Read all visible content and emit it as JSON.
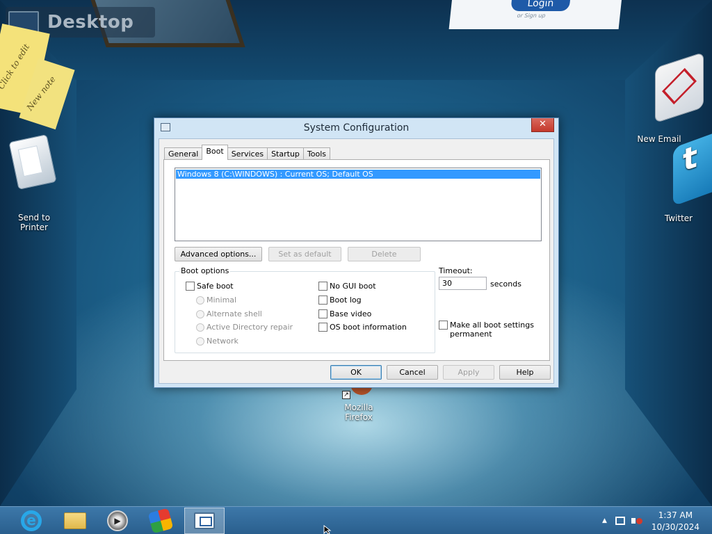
{
  "desktop": {
    "title": "Desktop",
    "notes": [
      "Click to edit",
      "New note"
    ],
    "login": {
      "button": "Login",
      "sub": "or Sign up"
    },
    "icons": {
      "send_to_printer": [
        "Send to",
        "Printer"
      ],
      "new_email": "New Email",
      "twitter": "Twitter",
      "firefox": [
        "Mozilla",
        "Firefox"
      ]
    }
  },
  "dialog": {
    "title": "System Configuration",
    "close_glyph": "✕",
    "tabs": [
      "General",
      "Boot",
      "Services",
      "Startup",
      "Tools"
    ],
    "active_tab": "Boot",
    "os_list": [
      "Windows 8 (C:\\WINDOWS) : Current OS; Default OS"
    ],
    "buttons": {
      "advanced": "Advanced options...",
      "set_default": "Set as default",
      "delete": "Delete"
    },
    "boot_options": {
      "legend": "Boot options",
      "safe_boot": "Safe boot",
      "minimal": "Minimal",
      "alternate_shell": "Alternate shell",
      "ad_repair": "Active Directory repair",
      "network": "Network",
      "no_gui_boot": "No GUI boot",
      "boot_log": "Boot log",
      "base_video": "Base video",
      "os_boot_info": "OS boot information"
    },
    "timeout": {
      "label": "Timeout:",
      "value": "30",
      "unit": "seconds"
    },
    "make_permanent": [
      "Make all boot settings",
      "permanent"
    ],
    "footer": {
      "ok": "OK",
      "cancel": "Cancel",
      "apply": "Apply",
      "help": "Help"
    }
  },
  "taskbar": {
    "apps": [
      "internet-explorer-icon",
      "file-explorer-icon",
      "media-player-icon",
      "store-icon",
      "msconfig-icon"
    ],
    "clock_time": "1:37 AM",
    "clock_date": "10/30/2024",
    "tray_arrow": "▲"
  },
  "colors": {
    "selection": "#3399ff",
    "taskbar": "#2f6a9a",
    "dialog_frame": "#d1e5f5"
  }
}
